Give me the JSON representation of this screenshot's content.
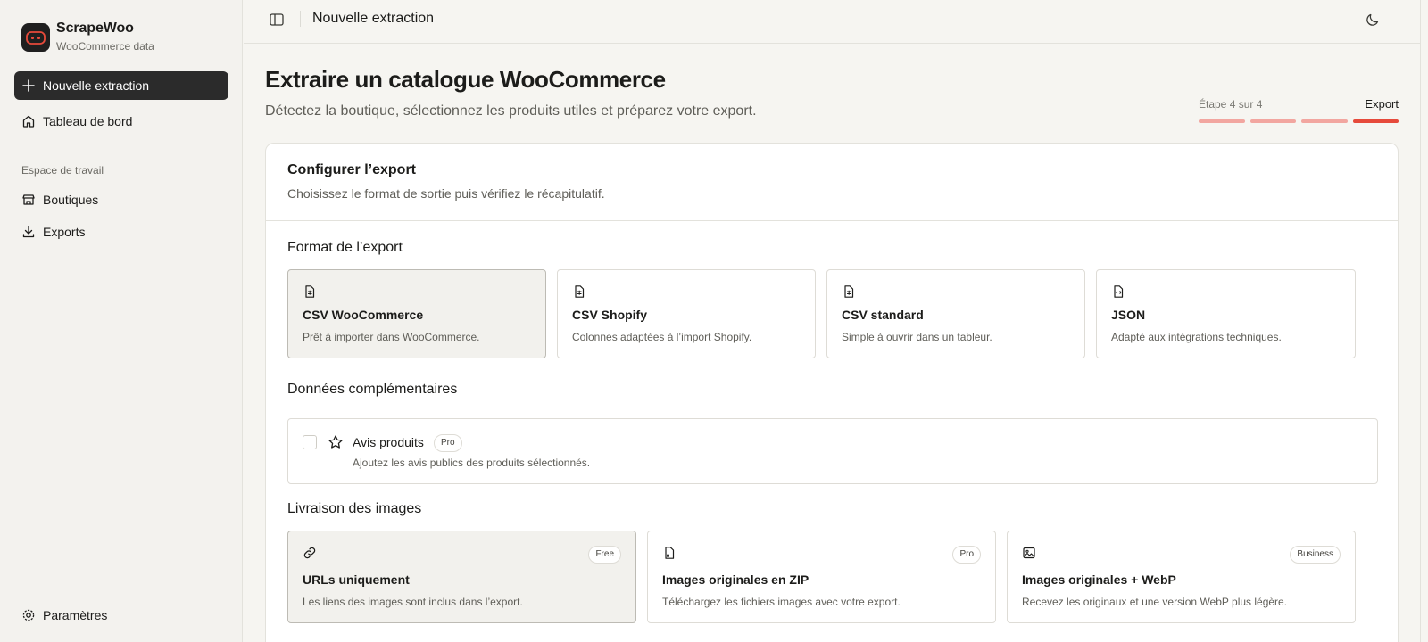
{
  "sidebar": {
    "brand": {
      "name": "ScrapeWoo",
      "subtitle": "WooCommerce data"
    },
    "new_extraction": "Nouvelle extraction",
    "dashboard": "Tableau de bord",
    "workspace_label": "Espace de travail",
    "shops": "Boutiques",
    "exports": "Exports",
    "settings": "Paramètres"
  },
  "topbar": {
    "title": "Nouvelle extraction"
  },
  "page": {
    "title": "Extraire un catalogue WooCommerce",
    "subtitle": "Détectez la boutique, sélectionnez les produits utiles et préparez votre export."
  },
  "stepper": {
    "label": "Étape 4 sur 4",
    "current": "Export",
    "total": 4,
    "active": 4
  },
  "card": {
    "title": "Configurer l’export",
    "subtitle": "Choisissez le format de sortie puis vérifiez le récapitulatif.",
    "format_section": "Format de l’export",
    "formats": [
      {
        "name": "CSV WooCommerce",
        "desc": "Prêt à importer dans WooCommerce.",
        "selected": true,
        "icon": "file-spreadsheet-icon"
      },
      {
        "name": "CSV Shopify",
        "desc": "Colonnes adaptées à l’import Shopify.",
        "selected": false,
        "icon": "file-spreadsheet-icon"
      },
      {
        "name": "CSV standard",
        "desc": "Simple à ouvrir dans un tableur.",
        "selected": false,
        "icon": "file-spreadsheet-icon"
      },
      {
        "name": "JSON",
        "desc": "Adapté aux intégrations techniques.",
        "selected": false,
        "icon": "file-json-icon"
      }
    ],
    "extra_section": "Données complémentaires",
    "extra": {
      "name": "Avis produits",
      "badge": "Pro",
      "desc": "Ajoutez les avis publics des produits sélectionnés.",
      "checked": false
    },
    "images_section": "Livraison des images",
    "images": [
      {
        "name": "URLs uniquement",
        "desc": "Les liens des images sont inclus dans l’export.",
        "badge": "Free",
        "selected": true,
        "icon": "link-icon"
      },
      {
        "name": "Images originales en ZIP",
        "desc": "Téléchargez les fichiers images avec votre export.",
        "badge": "Pro",
        "selected": false,
        "icon": "file-archive-icon"
      },
      {
        "name": "Images originales + WebP",
        "desc": "Recevez les originaux et une version WebP plus légère.",
        "badge": "Business",
        "selected": false,
        "icon": "image-icon"
      }
    ]
  },
  "colors": {
    "accent": "#e64a3b",
    "accent_light": "#f2a6a0",
    "primary_dark": "#2b2b2b"
  }
}
